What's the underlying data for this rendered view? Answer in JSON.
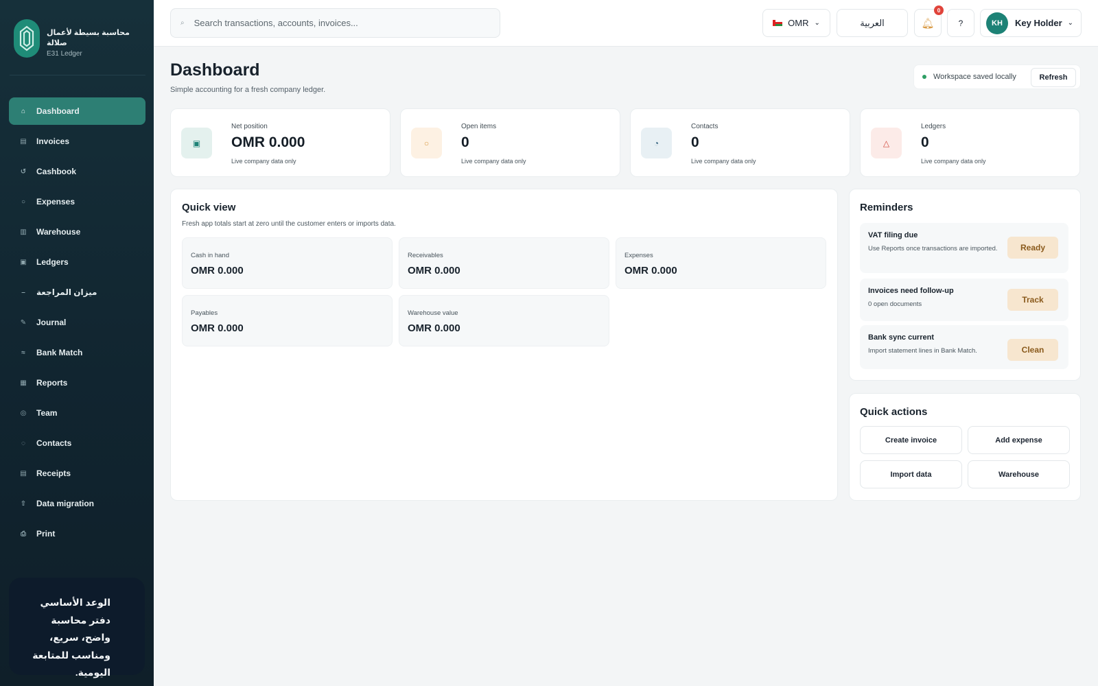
{
  "brand": {
    "name": "محاسبة بسيطة لأعمال صلالة",
    "subtitle": "E31 Ledger"
  },
  "sidebar": {
    "items": [
      {
        "label": "Dashboard",
        "icon": "home-icon",
        "glyph": "⌂",
        "active": true
      },
      {
        "label": "Invoices",
        "icon": "invoice-icon",
        "glyph": "▤"
      },
      {
        "label": "Cashbook",
        "icon": "cashbook-icon",
        "glyph": "↺"
      },
      {
        "label": "Expenses",
        "icon": "expenses-icon",
        "glyph": "○"
      },
      {
        "label": "Warehouse",
        "icon": "warehouse-icon",
        "glyph": "▥"
      },
      {
        "label": "Ledgers",
        "icon": "ledger-icon",
        "glyph": "▣"
      },
      {
        "label": "ميزان المراجعة",
        "icon": "trial-balance-icon",
        "glyph": "–"
      },
      {
        "label": "Journal",
        "icon": "journal-icon",
        "glyph": "✎"
      },
      {
        "label": "Bank Match",
        "icon": "bank-match-icon",
        "glyph": "≈"
      },
      {
        "label": "Reports",
        "icon": "reports-icon",
        "glyph": "▦"
      },
      {
        "label": "Team",
        "icon": "team-icon",
        "glyph": "◎"
      },
      {
        "label": "Contacts",
        "icon": "contacts-icon",
        "glyph": "◌"
      },
      {
        "label": "Receipts",
        "icon": "receipts-icon",
        "glyph": "▤"
      },
      {
        "label": "Data migration",
        "icon": "upload-icon",
        "glyph": "⇧"
      },
      {
        "label": "Print",
        "icon": "print-icon",
        "glyph": "⎙"
      }
    ],
    "promise": "الوعد الأساسي دفتر محاسبة واضح، سريع، ومناسب للمتابعة اليومية."
  },
  "topbar": {
    "search_placeholder": "Search transactions, accounts, invoices...",
    "currency": "OMR",
    "language": "العربية",
    "notifications_count": "0",
    "help": "?",
    "user_initials": "KH",
    "user_name": "Key Holder"
  },
  "header": {
    "title": "Dashboard",
    "subtitle": "Simple accounting for a fresh company ledger.",
    "saved_status": "Workspace saved locally",
    "refresh_label": "Refresh"
  },
  "stats": [
    {
      "label": "Net position",
      "value": "OMR 0.000",
      "note": "Live company data only",
      "icon": "wallet-icon",
      "color": "#e4f1ee",
      "fg": "#1d8276"
    },
    {
      "label": "Open items",
      "value": "0",
      "note": "Live company data only",
      "icon": "clock-icon",
      "color": "#fdf1e3",
      "fg": "#d99a45"
    },
    {
      "label": "Contacts",
      "value": "0",
      "note": "Live company data only",
      "icon": "contacts-icon",
      "color": "#e8f0f4",
      "fg": "#2e5d7a"
    },
    {
      "label": "Ledgers",
      "value": "0",
      "note": "Live company data only",
      "icon": "warning-icon",
      "color": "#fcebe8",
      "fg": "#d0473b"
    }
  ],
  "quick_view": {
    "title": "Quick view",
    "subtitle": "Fresh app totals start at zero until the customer enters or imports data.",
    "cards": [
      {
        "label": "Cash in hand",
        "value": "OMR 0.000"
      },
      {
        "label": "Receivables",
        "value": "OMR 0.000"
      },
      {
        "label": "Expenses",
        "value": "OMR 0.000"
      },
      {
        "label": "Payables",
        "value": "OMR 0.000"
      },
      {
        "label": "Warehouse value",
        "value": "OMR 0.000"
      }
    ]
  },
  "reminders": {
    "title": "Reminders",
    "items": [
      {
        "title": "VAT filing due",
        "desc": "Use Reports once transactions are imported.",
        "button": "Ready"
      },
      {
        "title": "Invoices need follow-up",
        "desc": "0 open documents",
        "button": "Track"
      },
      {
        "title": "Bank sync current",
        "desc": "Import statement lines in Bank Match.",
        "button": "Clean"
      }
    ]
  },
  "quick_actions": {
    "title": "Quick actions",
    "buttons": [
      "Create invoice",
      "Add expense",
      "Import data",
      "Warehouse"
    ]
  },
  "colors": {
    "accent": "#2d7f74",
    "sidebar": "#112530",
    "reminder_button": "#f7e6cf"
  }
}
